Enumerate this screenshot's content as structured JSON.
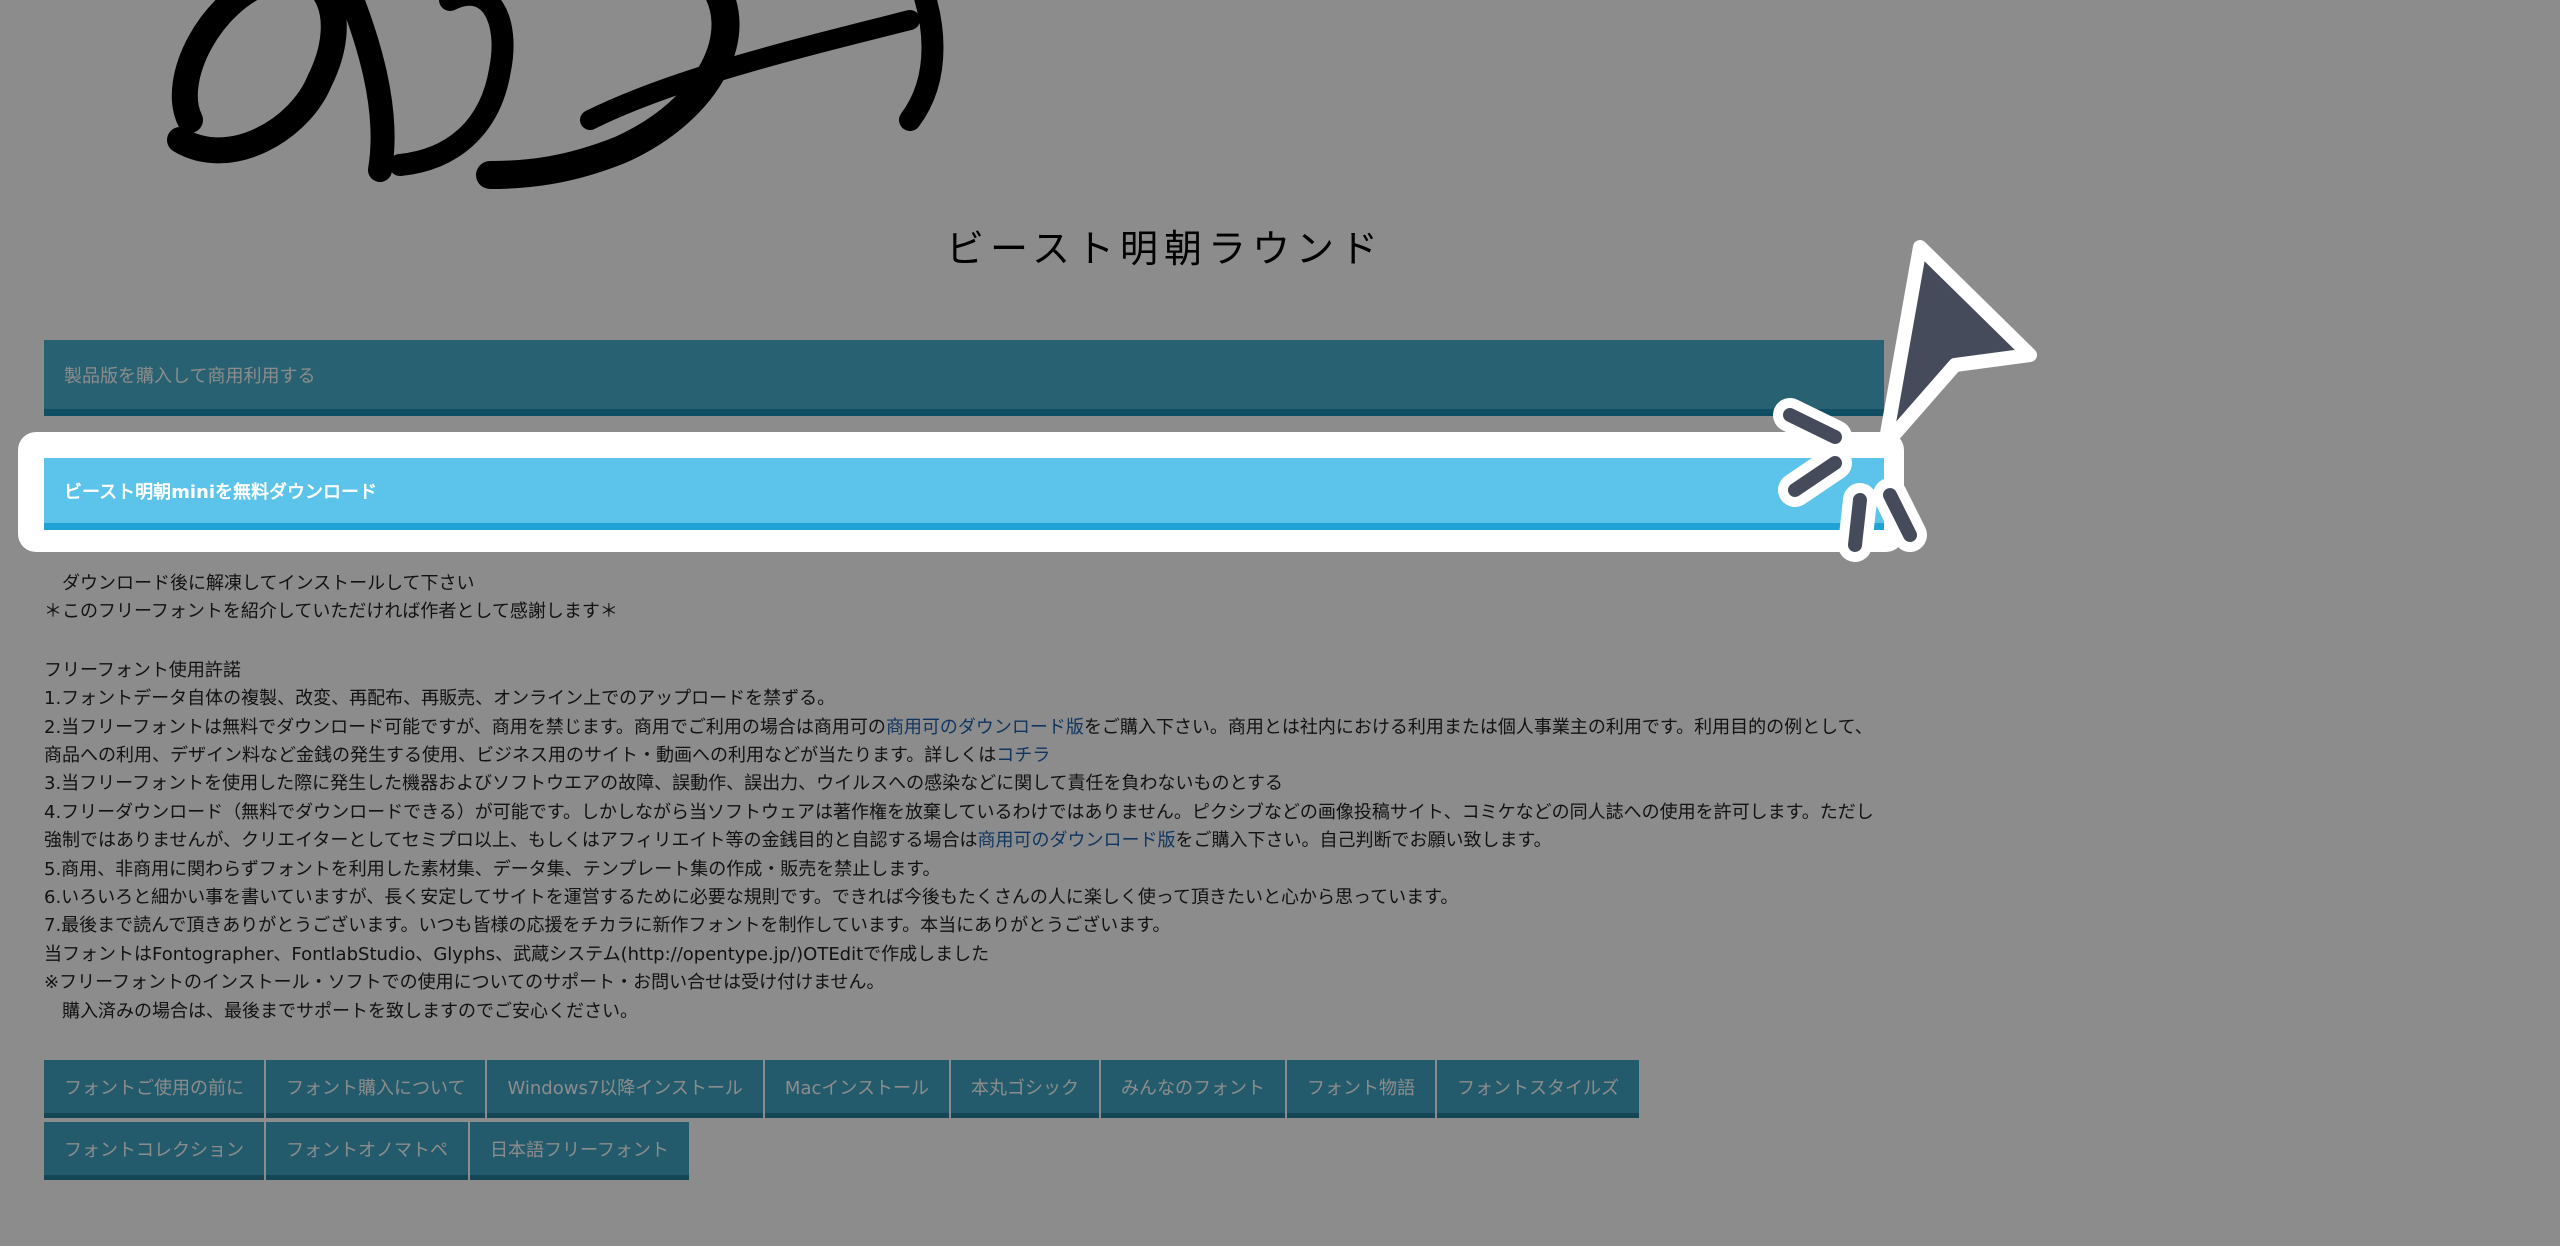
{
  "hero": {
    "title": "ビースト明朝ラウンド"
  },
  "buttons": {
    "buy_label": "製品版を購入して商用利用する",
    "free_download_label": "ビースト明朝miniを無料ダウンロード"
  },
  "notice": {
    "line1": "　ダウンロード後に解凍してインストールして下さい",
    "line2": "＊このフリーフォントを紹介していただければ作者として感謝します＊"
  },
  "license": {
    "heading": "フリーフォント使用許諾",
    "item1": "1.フォントデータ自体の複製、改変、再配布、再販売、オンライン上でのアップロードを禁ずる。",
    "item2_a": "2.当フリーフォントは無料でダウンロード可能ですが、商用を禁じます。商用でご利用の場合は商用可の",
    "item2_link": "商用可のダウンロード版",
    "item2_b": "をご購入下さい。商用とは社内における利用または個人事業主の利用です。利用目的の例として、商品への利用、デザイン料など金銭の発生する使用、ビジネス用のサイト・動画への利用などが当たります。詳しくは",
    "item2_link2": "コチラ",
    "item3": "3.当フリーフォントを使用した際に発生した機器およびソフトウエアの故障、誤動作、誤出力、ウイルスへの感染などに関して責任を負わないものとする",
    "item4_a": "4.フリーダウンロード（無料でダウンロードできる）が可能です。しかしながら当ソフトウェアは著作権を放棄しているわけではありません。ピクシブなどの画像投稿サイト、コミケなどの同人誌への使用を許可します。ただし強制ではありませんが、クリエイターとしてセミプロ以上、もしくはアフィリエイト等の金銭目的と自認する場合は",
    "item4_link": "商用可のダウンロード版",
    "item4_b": "をご購入下さい。自己判断でお願い致します。",
    "item5": "5.商用、非商用に関わらずフォントを利用した素材集、データ集、テンプレート集の作成・販売を禁止します。",
    "item6": "6.いろいろと細かい事を書いていますが、長く安定してサイトを運営するために必要な規則です。できれば今後もたくさんの人に楽しく使って頂きたいと心から思っています。",
    "item7": "7.最後まで読んで頂きありがとうございます。いつも皆様の応援をチカラに新作フォントを制作しています。本当にありがとうございます。",
    "tools": "当フォントはFontographer、FontlabStudio、Glyphs、武蔵システム(http://opentype.jp/)OTEditで作成しました",
    "support1": "※フリーフォントのインストール・ソフトでの使用についてのサポート・お問い合せは受け付けません。",
    "support2": "　購入済みの場合は、最後までサポートを致しますのでご安心ください。"
  },
  "nav": {
    "tabs": [
      "フォントご使用の前に",
      "フォント購入について",
      "Windows7以降インストール",
      "Macインストール",
      "本丸ゴシック",
      "みんなのフォント",
      "フォント物語",
      "フォントスタイルズ",
      "フォントコレクション",
      "フォントオノマトペ",
      "日本語フリーフォント"
    ]
  },
  "colors": {
    "buy_button": "#4ab1cf",
    "free_button": "#5cc4ea",
    "tab": "#41a7c6",
    "link": "#1e63b0",
    "cursor": "#454b5a"
  },
  "icons": {
    "cursor": "pointer-cursor-icon",
    "hero": "calligraphy-glyph-icon"
  }
}
